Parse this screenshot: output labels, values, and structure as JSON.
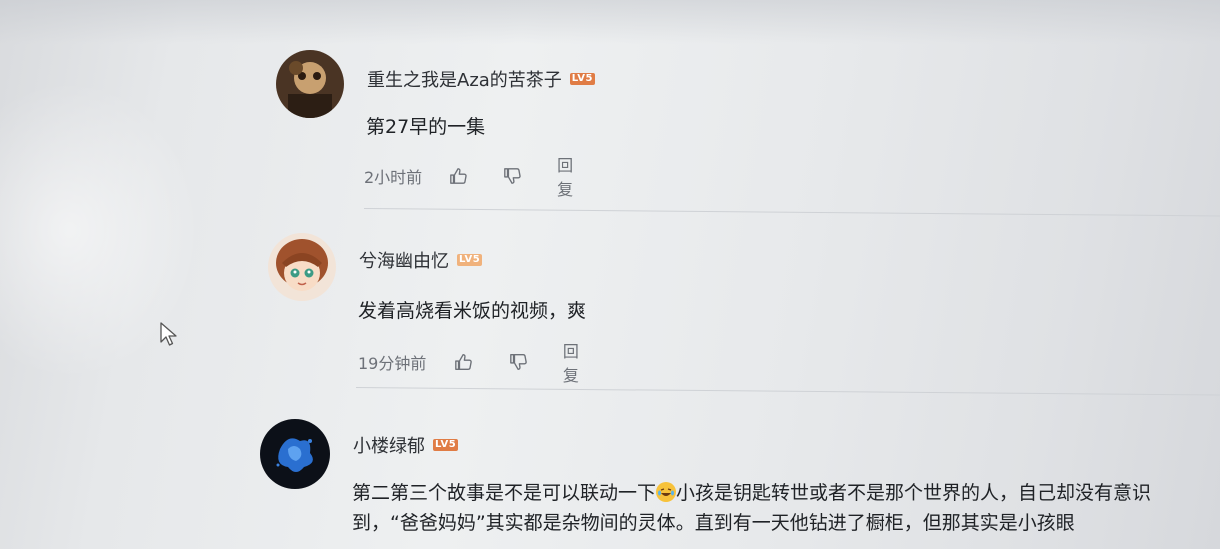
{
  "comments": [
    {
      "username": "重生之我是Aza的苦茶子",
      "level": "LV5",
      "text": "第27早的一集",
      "time": "2小时前",
      "reply_label": "回复",
      "avatar_icon": "avatar-dark-figure-icon"
    },
    {
      "username": "兮海幽由忆",
      "level": "LV5",
      "text": "发着高烧看米饭的视频，爽",
      "time": "19分钟前",
      "reply_label": "回复",
      "avatar_icon": "avatar-anime-girl-icon"
    },
    {
      "username": "小楼绿郁",
      "level": "LV5",
      "text_part1": "第二第三个故事是不是可以联动一下",
      "emoji": "crying-laughing-emoji",
      "text_part2": "小孩是钥匙转世或者不是那个世界的人，自己却没有意识到，“爸爸妈妈”其实都是杂物间的灵体。直到有一天他钻进了橱柜，但那其实是小孩眼",
      "avatar_icon": "avatar-blue-splash-icon"
    }
  ],
  "colors": {
    "level_badge": "#e07c45",
    "meta_text": "#6d7178",
    "body_text": "#1f2226"
  }
}
